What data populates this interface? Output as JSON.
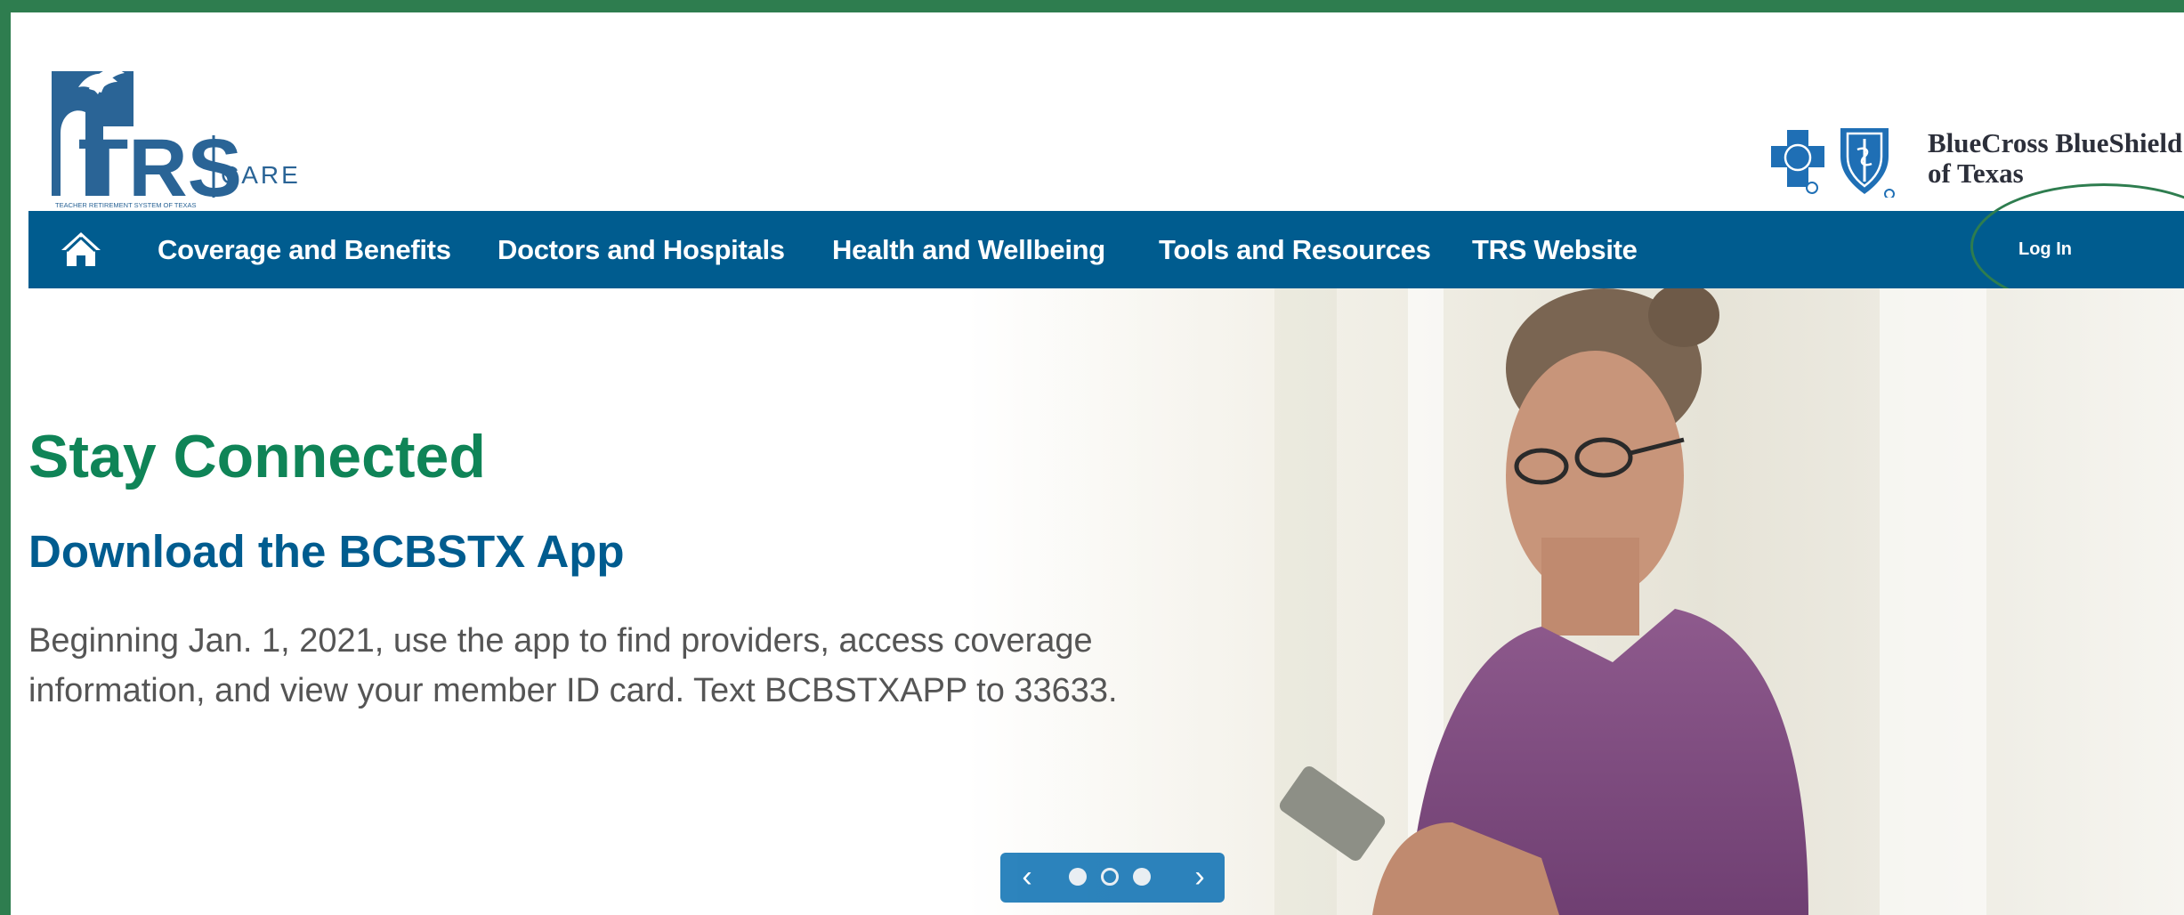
{
  "header": {
    "trs_logo": {
      "main": "TRS",
      "product": "CARE",
      "tagline": "TEACHER RETIREMENT SYSTEM OF TEXAS"
    },
    "bcbs_logo": {
      "line1": "BlueCross BlueShield",
      "line2": "of Texas"
    }
  },
  "nav": {
    "home_icon": "home-icon",
    "items": [
      {
        "label": "Coverage and Benefits"
      },
      {
        "label": "Doctors and Hospitals"
      },
      {
        "label": "Health and Wellbeing"
      },
      {
        "label": "Tools and Resources"
      },
      {
        "label": "TRS Website"
      }
    ],
    "login_label": "Log In"
  },
  "hero": {
    "title": "Stay Connected",
    "subtitle": "Download the BCBSTX App",
    "body": "Beginning Jan. 1, 2021, use the app to find providers, access coverage information, and view your member ID card. Text BCBSTXAPP to 33633.",
    "carousel": {
      "prev_symbol": "‹",
      "next_symbol": "›",
      "slide_count": 3,
      "active_slide": 2
    }
  },
  "colors": {
    "frame": "#2e7d4f",
    "nav_bg": "#005c8f",
    "title_green": "#0f8457",
    "subtitle_blue": "#005c8f",
    "body_text": "#555555",
    "carousel_bg": "#1b79b7"
  }
}
